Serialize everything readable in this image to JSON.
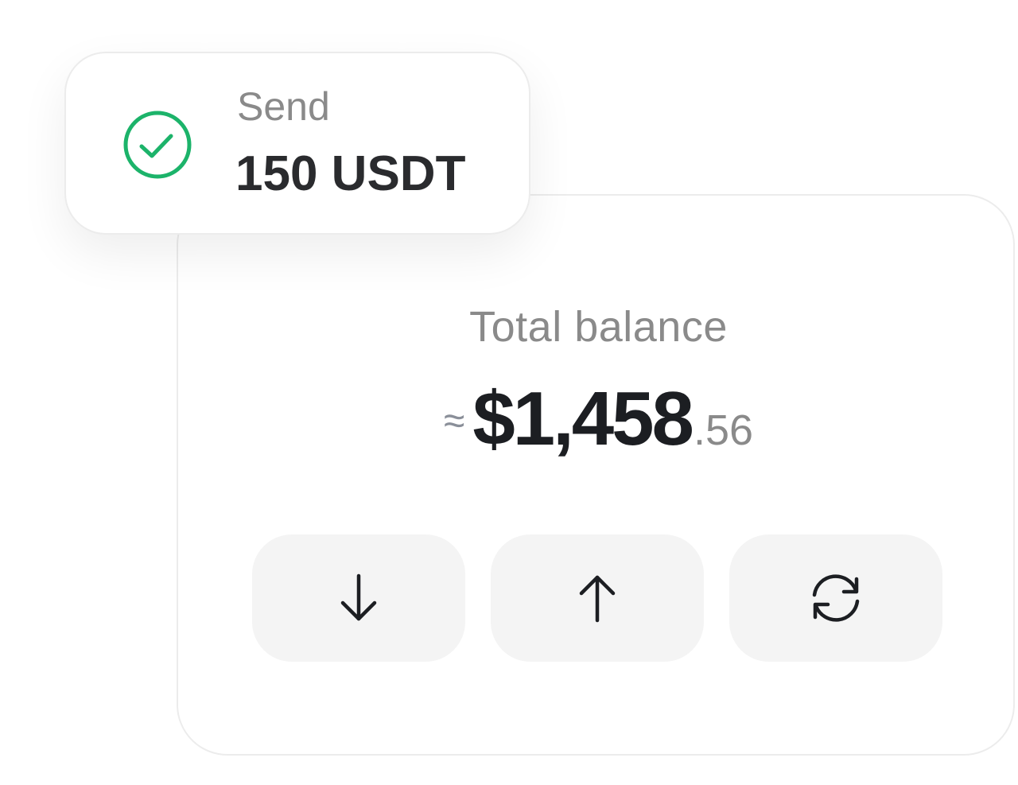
{
  "send_card": {
    "label": "Send",
    "amount": "150 USDT",
    "status_color": "#1cb36a"
  },
  "balance": {
    "label": "Total balance",
    "approx_symbol": "≈",
    "amount_main": "$1,458",
    "amount_cents": ".56"
  },
  "actions": [
    {
      "name": "receive",
      "icon": "arrow-down-icon"
    },
    {
      "name": "send",
      "icon": "arrow-up-icon"
    },
    {
      "name": "swap",
      "icon": "refresh-icon"
    }
  ]
}
